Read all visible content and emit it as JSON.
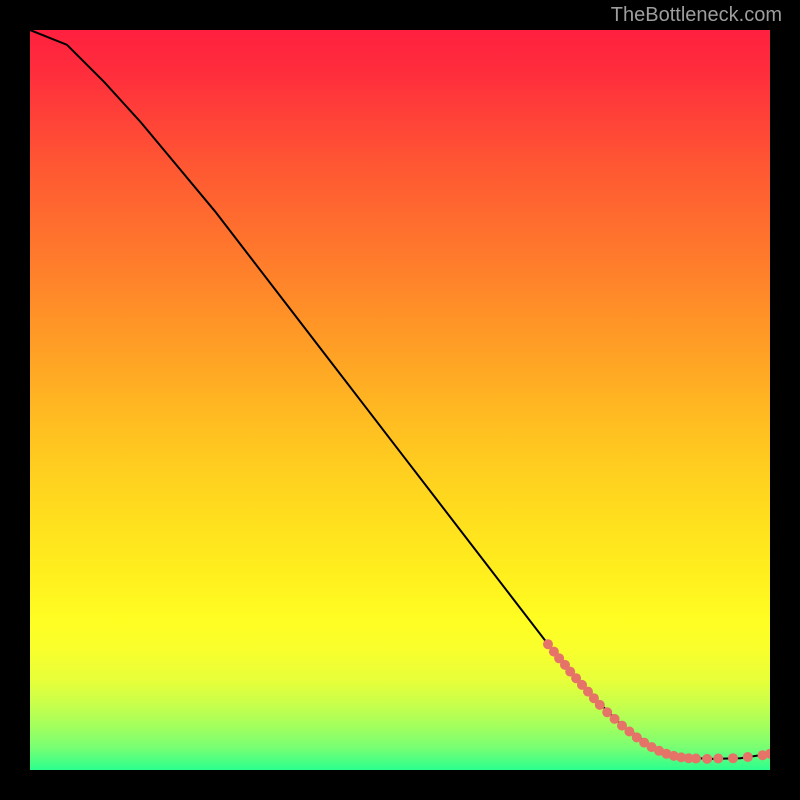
{
  "watermark": "TheBottleneck.com",
  "chart_data": {
    "type": "line",
    "title": "",
    "xlabel": "",
    "ylabel": "",
    "xlim": [
      0,
      100
    ],
    "ylim": [
      0,
      100
    ],
    "curve": [
      {
        "x": 0,
        "y": 100
      },
      {
        "x": 5,
        "y": 98
      },
      {
        "x": 10,
        "y": 93
      },
      {
        "x": 15,
        "y": 87.5
      },
      {
        "x": 20,
        "y": 81.5
      },
      {
        "x": 25,
        "y": 75.5
      },
      {
        "x": 30,
        "y": 69
      },
      {
        "x": 35,
        "y": 62.5
      },
      {
        "x": 40,
        "y": 56
      },
      {
        "x": 45,
        "y": 49.5
      },
      {
        "x": 50,
        "y": 43
      },
      {
        "x": 55,
        "y": 36.5
      },
      {
        "x": 60,
        "y": 30
      },
      {
        "x": 65,
        "y": 23.5
      },
      {
        "x": 70,
        "y": 17
      },
      {
        "x": 75,
        "y": 11
      },
      {
        "x": 80,
        "y": 6
      },
      {
        "x": 85,
        "y": 2.6
      },
      {
        "x": 88,
        "y": 1.7
      },
      {
        "x": 92,
        "y": 1.5
      },
      {
        "x": 96,
        "y": 1.6
      },
      {
        "x": 100,
        "y": 2.2
      }
    ],
    "markers": [
      {
        "x": 70.0,
        "y": 17.0
      },
      {
        "x": 70.8,
        "y": 16.0
      },
      {
        "x": 71.5,
        "y": 15.1
      },
      {
        "x": 72.3,
        "y": 14.2
      },
      {
        "x": 73.0,
        "y": 13.3
      },
      {
        "x": 73.8,
        "y": 12.4
      },
      {
        "x": 74.6,
        "y": 11.5
      },
      {
        "x": 75.4,
        "y": 10.6
      },
      {
        "x": 76.2,
        "y": 9.7
      },
      {
        "x": 77.0,
        "y": 8.8
      },
      {
        "x": 78.0,
        "y": 7.8
      },
      {
        "x": 79.0,
        "y": 6.9
      },
      {
        "x": 80.0,
        "y": 6.0
      },
      {
        "x": 81.0,
        "y": 5.2
      },
      {
        "x": 82.0,
        "y": 4.4
      },
      {
        "x": 83.0,
        "y": 3.7
      },
      {
        "x": 84.0,
        "y": 3.1
      },
      {
        "x": 85.0,
        "y": 2.6
      },
      {
        "x": 86.0,
        "y": 2.2
      },
      {
        "x": 87.0,
        "y": 1.9
      },
      {
        "x": 88.0,
        "y": 1.7
      },
      {
        "x": 89.0,
        "y": 1.6
      },
      {
        "x": 90.0,
        "y": 1.55
      },
      {
        "x": 91.5,
        "y": 1.5
      },
      {
        "x": 93.0,
        "y": 1.55
      },
      {
        "x": 95.0,
        "y": 1.6
      },
      {
        "x": 97.0,
        "y": 1.75
      },
      {
        "x": 99.0,
        "y": 2.0
      },
      {
        "x": 100.0,
        "y": 2.2
      }
    ],
    "marker_radius_px": 5,
    "background": "heatmap-vertical-red-to-green"
  }
}
